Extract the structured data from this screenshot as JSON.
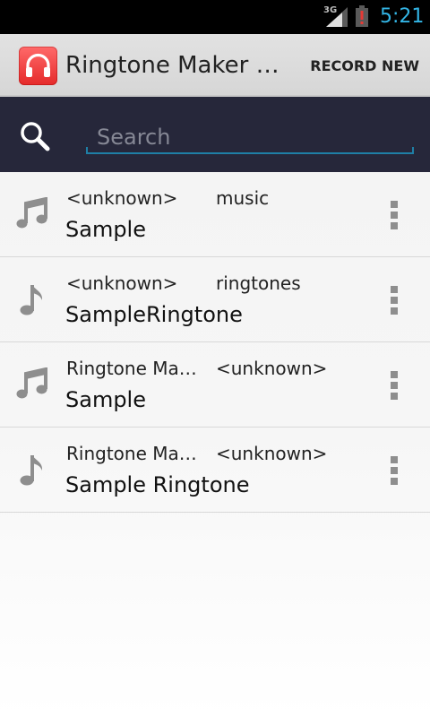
{
  "status_bar": {
    "network": "3G",
    "time": "5:21",
    "icons": [
      "signal-icon",
      "battery-alert-icon"
    ],
    "time_color": "#33b5e5"
  },
  "action_bar": {
    "title": "Ringtone Maker Music",
    "action_label": "RECORD NEW",
    "app_icon": "headphones-icon",
    "app_icon_color": "#e53935"
  },
  "search": {
    "placeholder": "Search",
    "value": "",
    "icon": "search-icon",
    "underline_color": "#1f7fa6"
  },
  "list": {
    "items": [
      {
        "artist": "<unknown>",
        "album": "music",
        "title": "Sample",
        "icon": "music-notes-icon",
        "menu_icon": "overflow-menu-icon"
      },
      {
        "artist": "<unknown>",
        "album": "ringtones",
        "title": "SampleRingtone",
        "icon": "music-note-icon",
        "menu_icon": "overflow-menu-icon"
      },
      {
        "artist": "Ringtone Maker Music",
        "album": "<unknown>",
        "title": "Sample",
        "icon": "music-notes-icon",
        "menu_icon": "overflow-menu-icon"
      },
      {
        "artist": "Ringtone Maker Music",
        "album": "<unknown>",
        "title": "Sample Ringtone",
        "icon": "music-note-icon",
        "menu_icon": "overflow-menu-icon"
      }
    ]
  }
}
